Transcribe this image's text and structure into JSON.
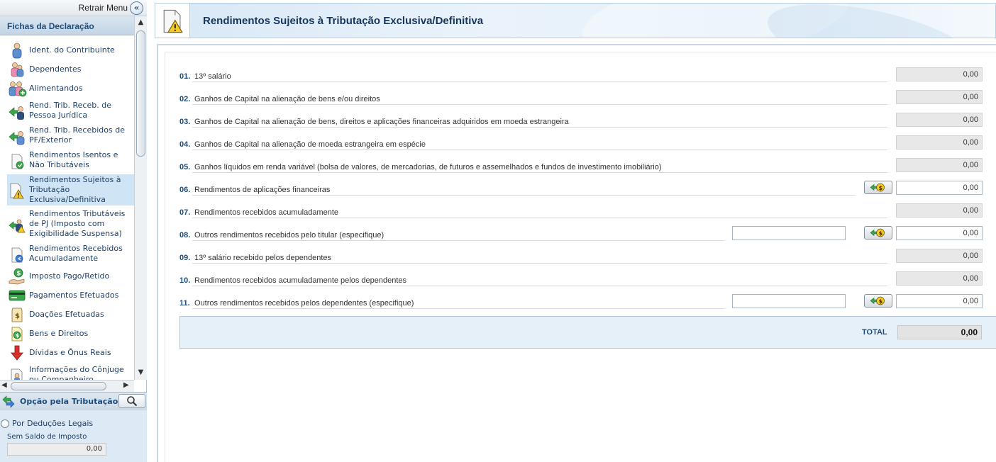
{
  "sidebar": {
    "retrair_menu": "Retrair Menu",
    "fichas_title": "Fichas da Declaração",
    "items": [
      {
        "label": "Ident. do Contribuinte",
        "icon": "person-icon"
      },
      {
        "label": "Dependentes",
        "icon": "dependents-icon"
      },
      {
        "label": "Alimentandos",
        "icon": "alimentandos-icon"
      },
      {
        "label": "Rend. Trib. Receb. de Pessoa Jurídica",
        "icon": "income-pj-icon"
      },
      {
        "label": "Rend. Trib. Recebidos de PF/Exterior",
        "icon": "income-pf-icon"
      },
      {
        "label": "Rendimentos Isentos e Não Tributáveis",
        "icon": "exempt-income-icon"
      },
      {
        "label": "Rendimentos Sujeitos à Tributação Exclusiva/Definitiva",
        "icon": "warning-document-icon",
        "selected": true
      },
      {
        "label": "Rendimentos Tributáveis de PJ (Imposto com Exigibilidade Suspensa)",
        "icon": "suspended-tax-icon"
      },
      {
        "label": "Rendimentos Recebidos Acumuladamente",
        "icon": "accumulated-income-icon"
      },
      {
        "label": "Imposto Pago/Retido",
        "icon": "tax-paid-icon"
      },
      {
        "label": "Pagamentos Efetuados",
        "icon": "payments-icon"
      },
      {
        "label": "Doações Efetuadas",
        "icon": "donations-icon"
      },
      {
        "label": "Bens e Direitos",
        "icon": "assets-icon"
      },
      {
        "label": "Dívidas e Ônus Reais",
        "icon": "debts-icon"
      },
      {
        "label": "Informações do Cônjuge ou Companheiro",
        "icon": "spouse-icon"
      }
    ],
    "opcao_title": "Opção pela Tributação:",
    "radio_label": "Por Deduções Legais",
    "saldo_label": "Sem Saldo de Imposto",
    "saldo_value": "0,00"
  },
  "main": {
    "title": "Rendimentos Sujeitos à Tributação Exclusiva/Definitiva",
    "rows": [
      {
        "num": "01.",
        "label": "13º salário",
        "value": "0,00"
      },
      {
        "num": "02.",
        "label": "Ganhos de Capital na alienação de bens e/ou direitos",
        "value": "0,00"
      },
      {
        "num": "03.",
        "label": "Ganhos de Capital na alienação de bens, direitos e aplicações financeiras adquiridos em moeda estrangeira",
        "value": "0,00"
      },
      {
        "num": "04.",
        "label": "Ganhos de Capital na alienação de moeda estrangeira em espécie",
        "value": "0,00"
      },
      {
        "num": "05.",
        "label": "Ganhos líquidos em renda variável (bolsa de valores, de mercadorias, de futuros e assemelhados e fundos de investimento imobiliário)",
        "value": "0,00"
      },
      {
        "num": "06.",
        "label": "Rendimentos de aplicações financeiras",
        "value": "0,00"
      },
      {
        "num": "07.",
        "label": "Rendimentos recebidos acumuladamente",
        "value": "0,00"
      },
      {
        "num": "08.",
        "label": "Outros rendimentos recebidos pelo titular (especifique)",
        "value": "0,00"
      },
      {
        "num": "09.",
        "label": "13º salário recebido pelos dependentes",
        "value": "0,00"
      },
      {
        "num": "10.",
        "label": "Rendimentos recebidos acumuladamente pelos dependentes",
        "value": "0,00"
      },
      {
        "num": "11.",
        "label": "Outros rendimentos recebidos pelos dependentes (especifique)",
        "value": "0,00"
      }
    ],
    "total_label": "TOTAL",
    "total_value": "0,00"
  }
}
